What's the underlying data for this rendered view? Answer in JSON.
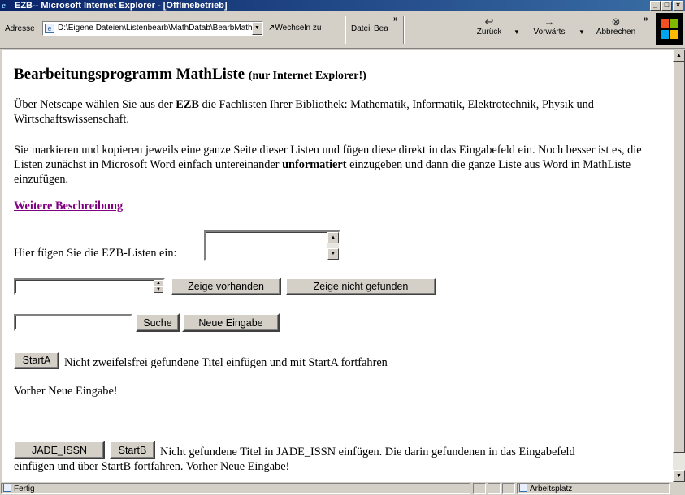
{
  "window": {
    "title": "EZB-- Microsoft Internet Explorer - [Offlinebetrieb]",
    "buttons": {
      "minimize": "_",
      "maximize": "□",
      "close": "×"
    }
  },
  "toolbar": {
    "address_label": "Adresse",
    "address_value": "D:\\Eigene Dateien\\Listenbearb\\MathDatab\\BearbMath.htm",
    "go_label": "Wechseln zu",
    "menu": [
      "Datei",
      "Bea"
    ],
    "more": "»",
    "back_label": "Zurück",
    "forward_label": "Vorwärts",
    "stop_label": "Abbrechen"
  },
  "page": {
    "title": "Bearbeitungsprogramm MathListe",
    "title_note": "(nur Internet Explorer!)",
    "para1_a": "Über Netscape wählen Sie aus der ",
    "para1_b": "EZB",
    "para1_c": " die Fachlisten Ihrer Bibliothek: Mathematik, Informatik, Elektrotechnik, Physik und Wirtschaftswissenschaft.",
    "para2_a": "Sie markieren und kopieren jeweils eine ganze Seite dieser Listen und fügen diese direkt in das Eingabefeld ein. Noch besser ist es, die Listen zunächst in Microsoft Word einfach untereinander ",
    "para2_b": "unformatiert",
    "para2_c": " einzugeben und dann die ganze Liste aus Word in MathListe einzufügen.",
    "link": "Weitere Beschreibung",
    "paste_label": "Hier fügen Sie die EZB-Listen ein:",
    "btn_show_existing": "Zeige vorhanden",
    "btn_show_not_found": "Zeige nicht gefunden",
    "search_value": "",
    "btn_search": "Suche",
    "btn_new_input": "Neue Eingabe",
    "btn_startA": "StartA",
    "startA_text": "Nicht zweifelsfrei gefundene Titel einfügen und mit StartA fortfahren",
    "prev_new_input": "Vorher Neue Eingabe!",
    "btn_jade": "JADE_ISSN",
    "btn_startB": "StartB",
    "startB_text": "Nicht gefundene Titel in JADE_ISSN einfügen. Die darin gefundenen in das Eingabefeld",
    "startB_text2": "einfügen und über StartB fortfahren. Vorher Neue Eingabe!"
  },
  "status": {
    "left": "Fertig",
    "zone": "Arbeitsplatz"
  }
}
